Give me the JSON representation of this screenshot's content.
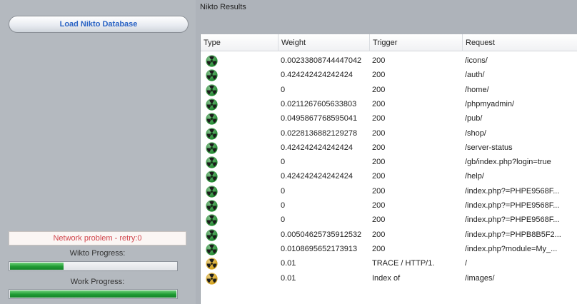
{
  "left_panel": {
    "load_button_label": "Load Nikto Database",
    "network_status": "Network problem - retry:0",
    "wikto_progress_label": "Wikto Progress:",
    "wikto_progress_value": 0.32,
    "work_progress_label": "Work Progress:",
    "work_progress_value": 1.0
  },
  "results": {
    "title": "Nikto Results",
    "columns": [
      "Type",
      "Weight",
      "Trigger",
      "Request"
    ],
    "rows": [
      {
        "type": "green-radiation-icon",
        "weight": "0.00233808744447042",
        "trigger": "200",
        "request": "/icons/"
      },
      {
        "type": "green-radiation-icon",
        "weight": "0.424242424242424",
        "trigger": "200",
        "request": "/auth/"
      },
      {
        "type": "green-radiation-icon",
        "weight": "0",
        "trigger": "200",
        "request": "/home/"
      },
      {
        "type": "green-radiation-icon",
        "weight": "0.0211267605633803",
        "trigger": "200",
        "request": "/phpmyadmin/"
      },
      {
        "type": "green-radiation-icon",
        "weight": "0.0495867768595041",
        "trigger": "200",
        "request": "/pub/"
      },
      {
        "type": "green-radiation-icon",
        "weight": "0.0228136882129278",
        "trigger": "200",
        "request": "/shop/"
      },
      {
        "type": "green-radiation-icon",
        "weight": "0.424242424242424",
        "trigger": "200",
        "request": "/server-status"
      },
      {
        "type": "green-radiation-icon",
        "weight": "0",
        "trigger": "200",
        "request": "/gb/index.php?login=true"
      },
      {
        "type": "green-radiation-icon",
        "weight": "0.424242424242424",
        "trigger": "200",
        "request": "/help/"
      },
      {
        "type": "green-radiation-icon",
        "weight": "0",
        "trigger": "200",
        "request": "/index.php?=PHPE9568F..."
      },
      {
        "type": "green-radiation-icon",
        "weight": "0",
        "trigger": "200",
        "request": "/index.php?=PHPE9568F..."
      },
      {
        "type": "green-radiation-icon",
        "weight": "0",
        "trigger": "200",
        "request": "/index.php?=PHPE9568F..."
      },
      {
        "type": "green-radiation-icon",
        "weight": "0.00504625735912532",
        "trigger": "200",
        "request": "/index.php?=PHPB8B5F2..."
      },
      {
        "type": "green-radiation-icon",
        "weight": "0.0108695652173913",
        "trigger": "200",
        "request": "/index.php?module=My_..."
      },
      {
        "type": "yellow-radiation-icon",
        "weight": "0.01",
        "trigger": "TRACE / HTTP/1.",
        "request": "/"
      },
      {
        "type": "yellow-radiation-icon",
        "weight": "0.01",
        "trigger": "Index of",
        "request": "/images/"
      }
    ]
  },
  "colors": {
    "green_icon": "#1f8a2e",
    "yellow_icon": "#d4a21a",
    "status_text": "#d0454c",
    "button_text": "#2a63c4",
    "progress_fill": "#1e9c33"
  }
}
